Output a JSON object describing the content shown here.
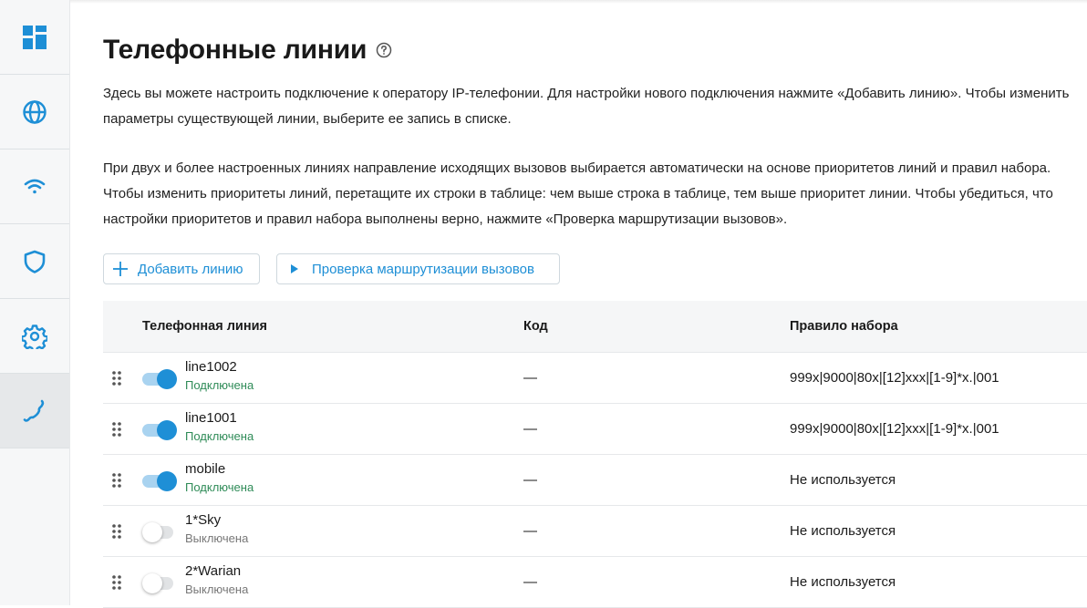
{
  "sidebar": {
    "items": [
      {
        "icon": "dashboard-icon",
        "active": false
      },
      {
        "icon": "globe-icon",
        "active": false
      },
      {
        "icon": "wifi-icon",
        "active": false
      },
      {
        "icon": "shield-icon",
        "active": false
      },
      {
        "icon": "gear-icon",
        "active": false
      },
      {
        "icon": "phone-icon",
        "active": true
      }
    ]
  },
  "page": {
    "title": "Телефонные линии",
    "help_icon": "help-circle-icon",
    "paragraph1": "Здесь вы можете настроить подключение к оператору IP-телефонии. Для настройки нового подключения нажмите «Добавить линию». Чтобы изменить параметры существующей линии, выберите ее запись в списке.",
    "paragraph2": "При двух и более настроенных линиях направление исходящих вызовов выбирается автоматически на основе приоритетов линий и правил набора. Чтобы изменить приоритеты линий, перетащите их строки в таблице: чем выше строка в таблице, тем выше приоритет линии. Чтобы убедиться, что настройки приоритетов и правил набора выполнены верно, нажмите «Проверка маршрутизации вызовов»."
  },
  "toolbar": {
    "add_label": "Добавить линию",
    "check_label": "Проверка маршрутизации вызовов"
  },
  "table": {
    "headers": {
      "line": "Телефонная линия",
      "code": "Код",
      "rule": "Правило набора"
    },
    "rows": [
      {
        "name": "line1002",
        "status": "Подключена",
        "enabled": true,
        "code": "—",
        "rule": "999x|9000|80x|[12]xxx|[1-9]*x.|001"
      },
      {
        "name": "line1001",
        "status": "Подключена",
        "enabled": true,
        "code": "—",
        "rule": "999x|9000|80x|[12]xxx|[1-9]*x.|001"
      },
      {
        "name": "mobile",
        "status": "Подключена",
        "enabled": true,
        "code": "—",
        "rule": "Не используется"
      },
      {
        "name": "1*Sky",
        "status": "Выключена",
        "enabled": false,
        "code": "—",
        "rule": "Не используется"
      },
      {
        "name": "2*Warian",
        "status": "Выключена",
        "enabled": false,
        "code": "—",
        "rule": "Не используется"
      }
    ]
  },
  "colors": {
    "accent": "#1e8fd6",
    "status_on": "#2e8b57",
    "status_off": "#777777"
  }
}
